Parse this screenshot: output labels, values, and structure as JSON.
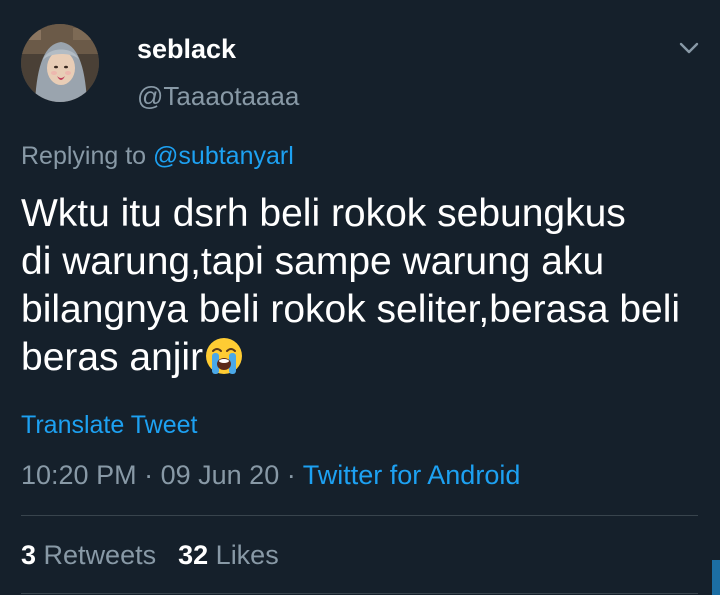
{
  "author": {
    "display_name": "seblack",
    "handle": "@Taaaotaaaa"
  },
  "reply": {
    "prefix": "Replying to",
    "mention": "@subtanyarl"
  },
  "tweet": {
    "lines": [
      "Wktu itu dsrh beli rokok sebungkus",
      "di warung,tapi sampe warung aku",
      "bilangnya beli rokok seliter,berasa beli",
      "beras anjir"
    ],
    "emoji": "loudly-crying-face"
  },
  "translate_label": "Translate Tweet",
  "meta": {
    "time": "10:20 PM",
    "date": "09 Jun 20",
    "separator": "·",
    "source": "Twitter for Android"
  },
  "stats": {
    "retweets_count": "3",
    "retweets_label": "Retweets",
    "likes_count": "32",
    "likes_label": "Likes"
  },
  "colors": {
    "background": "#15202b",
    "link": "#1da1f2",
    "muted": "#8899a6"
  }
}
